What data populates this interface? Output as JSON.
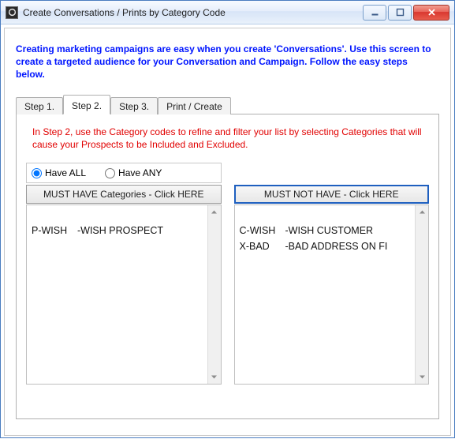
{
  "window": {
    "title": "Create Conversations / Prints by Category Code"
  },
  "intro": "Creating marketing campaigns are easy when you create 'Conversations'.  Use this screen to create a targeted audience for your Conversation and Campaign.  Follow the easy steps below.",
  "tabs": {
    "items": [
      {
        "label": "Step 1."
      },
      {
        "label": "Step 2."
      },
      {
        "label": "Step 3."
      },
      {
        "label": "Print / Create"
      }
    ],
    "activeIndex": 1
  },
  "step2": {
    "instructions": "In Step 2, use the Category codes to refine and filter your list by selecting Categories that will cause your Prospects to be Included and Excluded.",
    "radios": {
      "have_all": "Have ALL",
      "have_any": "Have ANY",
      "selected": "have_all"
    },
    "include": {
      "header": "MUST HAVE Categories - Click HERE",
      "rows": [
        {
          "code": "P-WISH",
          "desc": "-WISH PROSPECT"
        }
      ]
    },
    "exclude": {
      "header": "MUST NOT HAVE - Click HERE",
      "rows": [
        {
          "code": "C-WISH",
          "desc": "-WISH CUSTOMER"
        },
        {
          "code": "X-BAD",
          "desc": "-BAD ADDRESS ON FI"
        }
      ]
    }
  }
}
